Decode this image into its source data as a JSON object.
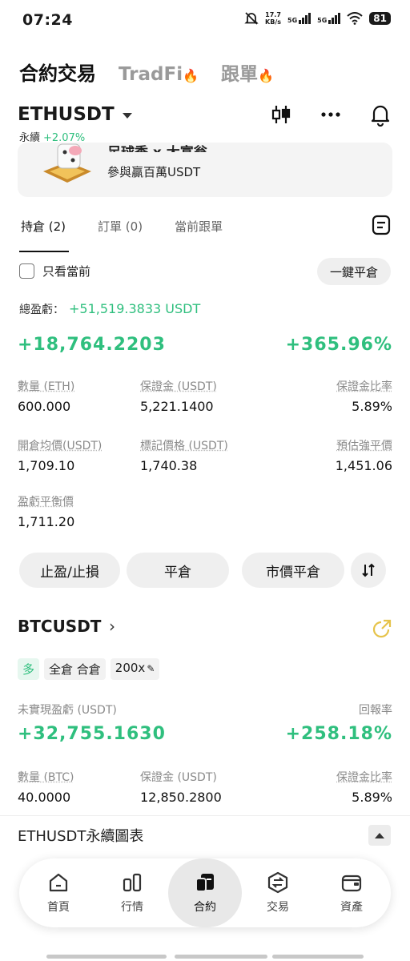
{
  "status_bar": {
    "time": "07:24",
    "net_speed_value": "17.7",
    "net_speed_unit": "KB/s",
    "sim1": "5G",
    "sim2": "5G",
    "battery": "81"
  },
  "top_tabs": {
    "main": "合約交易",
    "tradfi": "TradFi",
    "copy": "跟單"
  },
  "header": {
    "symbol": "ETHUSDT",
    "perp_label": "永續",
    "change": "+2.07%"
  },
  "banner": {
    "title": "足球季 x 大富翁",
    "subtitle": "參與贏百萬USDT"
  },
  "order_tabs": {
    "positions": "持倉 (2)",
    "orders": "訂單 (0)",
    "copy_orders": "當前跟單"
  },
  "filters": {
    "only_current": "只看當前",
    "close_all": "一鍵平倉"
  },
  "summary": {
    "total_pnl_label": "總盈虧：",
    "total_pnl_value": "+51,519.3833 USDT"
  },
  "eth_position": {
    "pnl": "+18,764.2203",
    "roe": "+365.96%",
    "qty_label": "數量 (ETH)",
    "qty": "600.000",
    "margin_label": "保證金 (USDT)",
    "margin": "5,221.1400",
    "margin_ratio_label": "保證金比率",
    "margin_ratio": "5.89%",
    "entry_label": "開倉均價(USDT)",
    "entry": "1,709.10",
    "mark_label": "標記價格 (USDT)",
    "mark": "1,740.38",
    "liq_label": "預估強平價",
    "liq": "1,451.06",
    "breakeven_label": "盈虧平衡價",
    "breakeven": "1,711.20"
  },
  "actions": {
    "tpsl": "止盈/止損",
    "close": "平倉",
    "market_close": "市價平倉"
  },
  "btc_position": {
    "symbol": "BTCUSDT",
    "side": "多",
    "mode": "全倉 合倉",
    "leverage": "200x",
    "upnl_label": "未實現盈虧 (USDT)",
    "roe_label": "回報率",
    "upnl": "+32,755.1630",
    "roe": "+258.18%",
    "qty_label": "數量 (BTC)",
    "qty": "40.0000",
    "margin_label": "保證金 (USDT)",
    "margin": "12,850.2800",
    "margin_ratio_label": "保證金比率",
    "margin_ratio": "5.89%"
  },
  "chart_section": {
    "label": "ETHUSDT永續圖表"
  },
  "bottom_nav": {
    "home": "首頁",
    "markets": "行情",
    "futures": "合約",
    "trade": "交易",
    "assets": "資產"
  },
  "colors": {
    "accent_green": "#2fbf7e",
    "fire": "#f08a2c",
    "share_gold": "#e6c34a"
  }
}
